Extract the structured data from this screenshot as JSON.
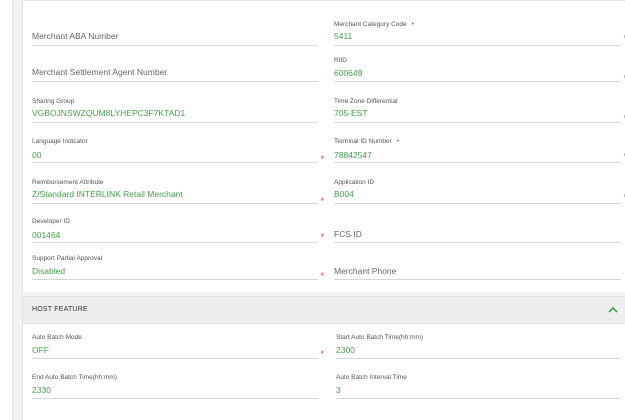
{
  "fields": {
    "merchant_aba": {
      "placeholder": "Merchant ABA Number"
    },
    "merchant_category_code": {
      "label": "Merchant Category Code",
      "value": "5411"
    },
    "settlement_agent": {
      "placeholder": "Merchant Settlement Agent Number"
    },
    "riid": {
      "label": "RIID",
      "value": "600649"
    },
    "sharing_group": {
      "label": "Sharing Group",
      "value": "VGBOJNSWZQUM8LYHEPC3F7KTAD1"
    },
    "time_zone": {
      "label": "Time Zone Differential",
      "value": "705-EST"
    },
    "language": {
      "label": "Language Indicator",
      "value": "00"
    },
    "terminal_id": {
      "label": "Terminal ID Number",
      "value": "78842547"
    },
    "reimbursement": {
      "label": "Reimbursement Attribute",
      "value": "Z/Standard INTERLINK Retail Merchant"
    },
    "application_id": {
      "label": "Application ID",
      "value": "B004"
    },
    "developer_id": {
      "label": "Developer ID",
      "value": "001464"
    },
    "fcs_id": {
      "placeholder": "FCS ID"
    },
    "partial_approval": {
      "label": "Support Partial Approval",
      "value": "Disabled"
    },
    "merchant_phone": {
      "placeholder": "Merchant Phone"
    }
  },
  "host_feature": {
    "title": "HOST FEATURE",
    "auto_batch_mode": {
      "label": "Auto Batch Mode",
      "value": "OFF"
    },
    "start_time": {
      "label": "Start Auto Batch Time(hh:mm)",
      "value": "2300"
    },
    "end_time": {
      "label": "End Auto Batch Time(hh:mm)",
      "value": "2330"
    },
    "interval": {
      "label": "Auto Batch Interval Time",
      "value": "3"
    }
  },
  "required_marker": "*",
  "colors": {
    "value": "#43a047",
    "required": "#e53935",
    "header_bg": "#eeeeee",
    "background": "#f2f2f2"
  },
  "icons": {
    "collapse": "chevron-up-icon"
  }
}
